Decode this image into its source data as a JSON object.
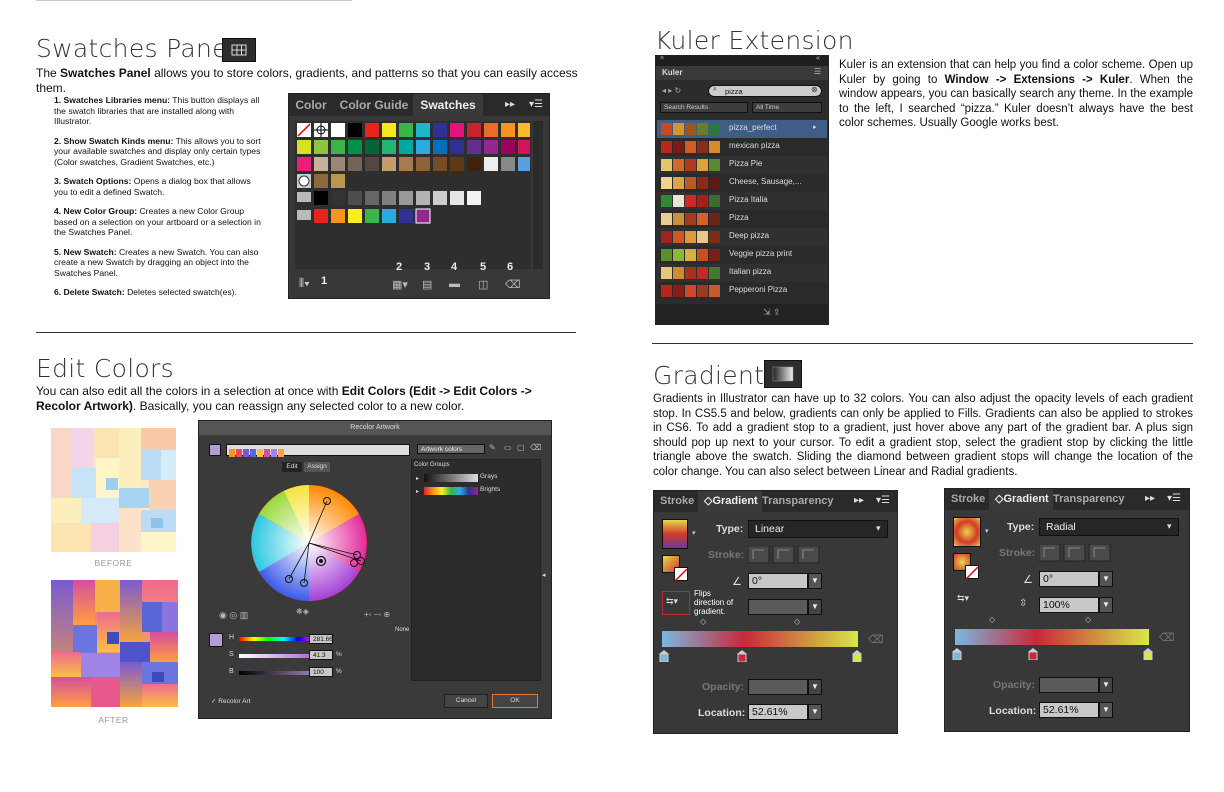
{
  "swatches": {
    "title": "Swatches Panel",
    "intro_pre": "The ",
    "intro_bold": "Swatches Panel",
    "intro_post": " allows you to store colors, gradients, and patterns so that you can easily access them.",
    "items": [
      {
        "bold": "1. Swatches Libraries menu:",
        "text": " This button displays all the swatch libraries that are installed along with Illustrator."
      },
      {
        "bold": "2. Show Swatch Kinds menu:",
        "text": " This allows you to sort your available swatches and display only certain types (Color swatches, Gradient Swatches, etc.)"
      },
      {
        "bold": "3. Swatch Options:",
        "text": " Opens a dialog box that allows you to edit a defined Swatch."
      },
      {
        "bold": "4. New Color Group:",
        "text": " Creates a new Color Group based on a selection on your artboard or a selection in the Swatches Panel."
      },
      {
        "bold": "5. New Swatch:",
        "text": " Creates a new Swatch. You can also create a new Swatch by dragging an object into the Swatches Panel."
      },
      {
        "bold": "6. Delete Swatch:",
        "text": " Deletes selected swatch(es)."
      }
    ],
    "panel": {
      "tabs": [
        "Color",
        "Color Guide",
        "Swatches"
      ],
      "active_tab": "Swatches",
      "numbers": [
        "1",
        "2",
        "3",
        "4",
        "5",
        "6"
      ]
    }
  },
  "edit_colors": {
    "title": "Edit Colors",
    "intro_pre": "You can also edit all the colors in a selection at once with ",
    "intro_bold": "Edit Colors (Edit -> Edit Colors -> Recolor Artwork)",
    "intro_post": ". Basically, you can reassign any selected color to a new color.",
    "before_label": "BEFORE",
    "after_label": "AFTER",
    "dialog": {
      "title": "Recolor Artwork",
      "dropdown": "Artwork colors",
      "tabs": [
        "Edit",
        "Assign"
      ],
      "groups_label": "Color Groups",
      "groups": [
        "Grays",
        "Brights"
      ],
      "h_label": "H",
      "h_value": "281.66",
      "s_label": "S",
      "s_value": "41.3",
      "b_label": "B",
      "b_value": "100",
      "percent": "%",
      "none_label": "None",
      "recolor_label": "Recolor Art",
      "cancel": "Cancel",
      "ok": "OK"
    }
  },
  "kuler": {
    "title": "Kuler Extension",
    "p_pre": "Kuler is an extension that can help you find a color scheme. Open up Kuler by going to ",
    "p_bold": "Window -> Extensions -> Kuler",
    "p_post": ". When the window appears, you can basically search any theme. In the example to the left, I searched “pizza.” Kuler doesn’t always have the best color schemes. Usually Google works best.",
    "panel": {
      "tab": "Kuler",
      "search": "pizza",
      "filter1": "Search Results",
      "filter2": "All Time",
      "rows": [
        {
          "name": "pizza_perfect",
          "colors": [
            "#c74a1a",
            "#d9932c",
            "#a0541e",
            "#6d7c2a",
            "#2c7a3a"
          ]
        },
        {
          "name": "mexican pizza",
          "colors": [
            "#b9261b",
            "#7e1a16",
            "#d65a23",
            "#8a2b1b",
            "#d98c2e"
          ]
        },
        {
          "name": "Pizza Pie",
          "colors": [
            "#e7c66a",
            "#cf6a2a",
            "#b23a1b",
            "#e1a13a",
            "#5a8a2f"
          ]
        },
        {
          "name": "Cheese, Sausage,...",
          "colors": [
            "#f0d48c",
            "#d9a44a",
            "#b85b25",
            "#8a2b17",
            "#5c1a10"
          ]
        },
        {
          "name": "Pizza Italia",
          "colors": [
            "#2f8a35",
            "#e9e4d3",
            "#cf2a22",
            "#a81f1a",
            "#3b6e2a"
          ]
        },
        {
          "name": "Pizza",
          "colors": [
            "#e8cf8e",
            "#c9913a",
            "#a53a1f",
            "#d65f2e",
            "#6b2418"
          ]
        },
        {
          "name": "Deep pizza",
          "colors": [
            "#a3221a",
            "#d45425",
            "#e09a3a",
            "#e8c886",
            "#7d2c16"
          ]
        },
        {
          "name": "Veggie pizza print",
          "colors": [
            "#5b8f2b",
            "#8fb53a",
            "#d8b13d",
            "#c9501f",
            "#7a1e17"
          ]
        },
        {
          "name": "Italian pizza",
          "colors": [
            "#e6c878",
            "#cf8a34",
            "#a8301c",
            "#c42a1f",
            "#3f7a2e"
          ]
        },
        {
          "name": "Pepperoni Pizza",
          "colors": [
            "#b7261b",
            "#8a1d16",
            "#d4462a",
            "#9a3a1f",
            "#c95a2a"
          ]
        }
      ]
    }
  },
  "gradients": {
    "title": "Gradients",
    "p_pre": "Gradients in Illustrator can have up to 32 colors. You can also adjust the opacity levels of each gradient stop.  In CS5.5 and below, gradients can only be applied to Fills. Gradients can also be applied to strokes in CS6. To add a gradient stop to a gradient, just hover above any part of the gradient bar. A plus sign should pop up next to your cursor. To edit a gradient stop, select the gradient stop by clicking the little triangle above the swatch. Sliding the diamond between gradient stops will change the location of the color change. You can also select between Linear and Radial gradients.",
    "panel1": {
      "tabs": [
        "Stroke",
        "Gradient",
        "Transparency"
      ],
      "type_label": "Type:",
      "type_value": "Linear",
      "stroke_label": "Stroke:",
      "angle": "0°",
      "flip_note": "Flips direction of gradient.",
      "opacity_label": "Opacity:",
      "location_label": "Location:",
      "location_value": "52.61%"
    },
    "panel2": {
      "tabs": [
        "Stroke",
        "Gradient",
        "Transparency"
      ],
      "type_label": "Type:",
      "type_value": "Radial",
      "stroke_label": "Stroke:",
      "angle": "0°",
      "aspect": "100%",
      "opacity_label": "Opacity:",
      "location_label": "Location:",
      "location_value": "52.61%"
    }
  }
}
